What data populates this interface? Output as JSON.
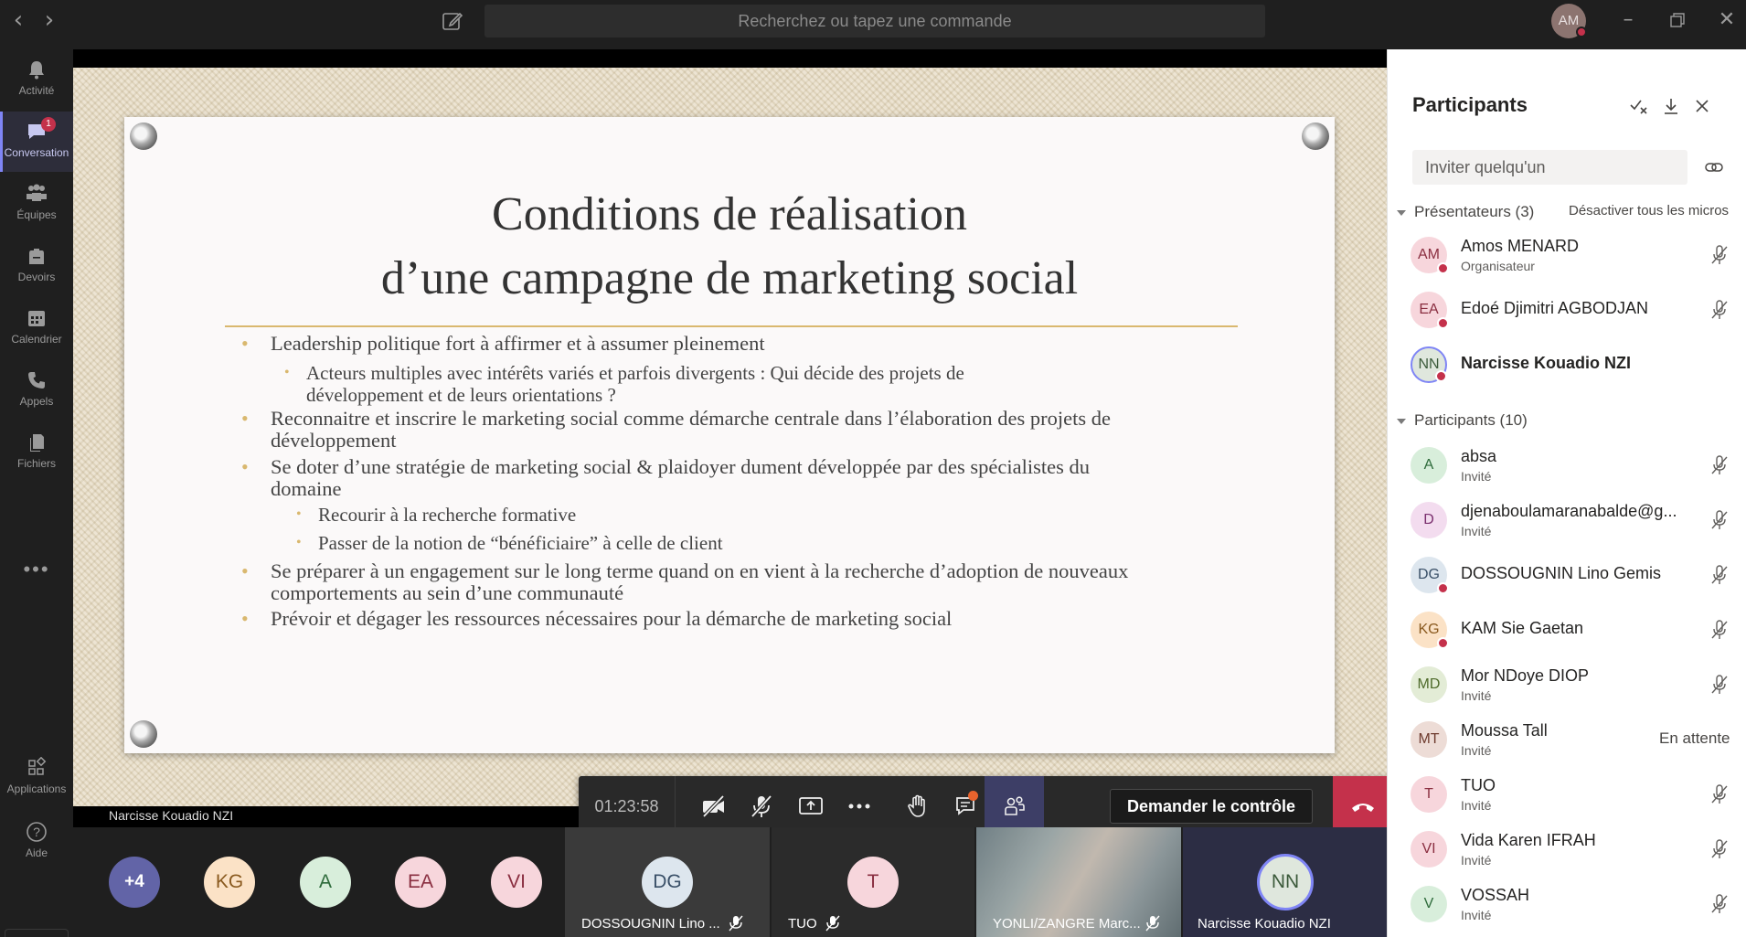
{
  "topbar": {
    "search_placeholder": "Recherchez ou tapez une commande",
    "back_icon": "chevron-left",
    "forward_icon": "chevron-right",
    "me_initials": "AM"
  },
  "rail": {
    "items": [
      {
        "label": "Activité",
        "icon": "bell"
      },
      {
        "label": "Conversation",
        "icon": "chat",
        "badge": "1"
      },
      {
        "label": "Équipes",
        "icon": "teams"
      },
      {
        "label": "Devoirs",
        "icon": "backpack"
      },
      {
        "label": "Calendrier",
        "icon": "calendar"
      },
      {
        "label": "Appels",
        "icon": "phone"
      },
      {
        "label": "Fichiers",
        "icon": "files"
      }
    ],
    "more": "•••",
    "apps": "Applications",
    "help": "Aide"
  },
  "slide": {
    "title_line1": "Conditions de réalisation",
    "title_line2": "d’une campagne de marketing social",
    "bullets": [
      "Leadership politique fort à affirmer et à assumer pleinement",
      "Acteurs multiples avec intérêts variés et parfois divergents : Qui décide des projets de développement et de leurs orientations ?",
      "Reconnaitre et inscrire le marketing social comme démarche centrale dans l’élaboration des projets de développement",
      "Se doter d’une  stratégie de marketing social & plaidoyer dument développée par des spécialistes du domaine",
      "Recourir à la recherche formative",
      "Passer de la notion de “bénéficiaire” à celle de client",
      "Se préparer à un engagement sur le long terme quand on en vient à la recherche d’adoption de nouveaux comportements au sein d’une communauté",
      "Prévoir et dégager les ressources nécessaires pour la démarche de marketing social"
    ],
    "presenter": "Narcisse Kouadio NZI"
  },
  "controls": {
    "timer": "01:23:58",
    "request_control": "Demander le contrôle"
  },
  "strip": {
    "overflow": "+4",
    "bubbles": [
      {
        "initials": "KG",
        "bg": "#fbe2c6",
        "fg": "#8a5a1f"
      },
      {
        "initials": "A",
        "bg": "#d8eedb",
        "fg": "#2e6b3b"
      },
      {
        "initials": "EA",
        "bg": "#f7d6dc",
        "fg": "#8a2e40"
      },
      {
        "initials": "VI",
        "bg": "#f7d6dc",
        "fg": "#8a2e40"
      }
    ],
    "tiles": [
      {
        "initials": "DG",
        "name": "DOSSOUGNIN Lino ..."
      },
      {
        "initials": "T",
        "name": "TUO"
      },
      {
        "name": "YONLI/ZANGRE Marc..."
      },
      {
        "initials": "NN",
        "name": "Narcisse Kouadio NZI"
      }
    ]
  },
  "panel": {
    "title": "Participants",
    "invite_placeholder": "Inviter quelqu'un",
    "presenters_header": "Présentateurs (3)",
    "mute_all": "Désactiver tous les micros",
    "participants_header": "Participants (10)",
    "presenters": [
      {
        "initials": "AM",
        "name": "Amos MENARD",
        "role": "Organisateur",
        "bg": "#f7d6dc",
        "fg": "#8a2e40"
      },
      {
        "initials": "EA",
        "name": "Edoé Djimitri AGBODJAN",
        "role": "",
        "bg": "#f7d6dc",
        "fg": "#8a2e40"
      },
      {
        "initials": "NN",
        "name": "Narcisse Kouadio NZI",
        "role": "",
        "bg": "#dfe7dd",
        "fg": "#3b5a3a"
      }
    ],
    "participants": [
      {
        "initials": "A",
        "name": "absa",
        "role": "Invité",
        "bg": "#d8eedb",
        "fg": "#2e6b3b"
      },
      {
        "initials": "D",
        "name": "djenaboulamaranabalde@g...",
        "role": "Invité",
        "bg": "#f3dcef",
        "fg": "#7a2f6e"
      },
      {
        "initials": "DG",
        "name": "DOSSOUGNIN Lino Gemis",
        "role": "",
        "bg": "#dde6ee",
        "fg": "#3a5068"
      },
      {
        "initials": "KG",
        "name": "KAM Sie Gaetan",
        "role": "",
        "bg": "#fbe2c6",
        "fg": "#8a5a1f"
      },
      {
        "initials": "MD",
        "name": "Mor NDoye DIOP",
        "role": "Invité",
        "bg": "#e3ecd6",
        "fg": "#4e6a2a"
      },
      {
        "initials": "MT",
        "name": "Moussa Tall",
        "role": "Invité",
        "bg": "#eddcd6",
        "fg": "#6e3b2e",
        "status": "En attente"
      },
      {
        "initials": "T",
        "name": "TUO",
        "role": "Invité",
        "bg": "#f7d6dc",
        "fg": "#8a2e40"
      },
      {
        "initials": "VI",
        "name": "Vida Karen IFRAH",
        "role": "Invité",
        "bg": "#f7d6dc",
        "fg": "#8a2e40"
      },
      {
        "initials": "V",
        "name": "VOSSAH",
        "role": "Invité",
        "bg": "#d8eedb",
        "fg": "#2e6b3b"
      }
    ]
  }
}
